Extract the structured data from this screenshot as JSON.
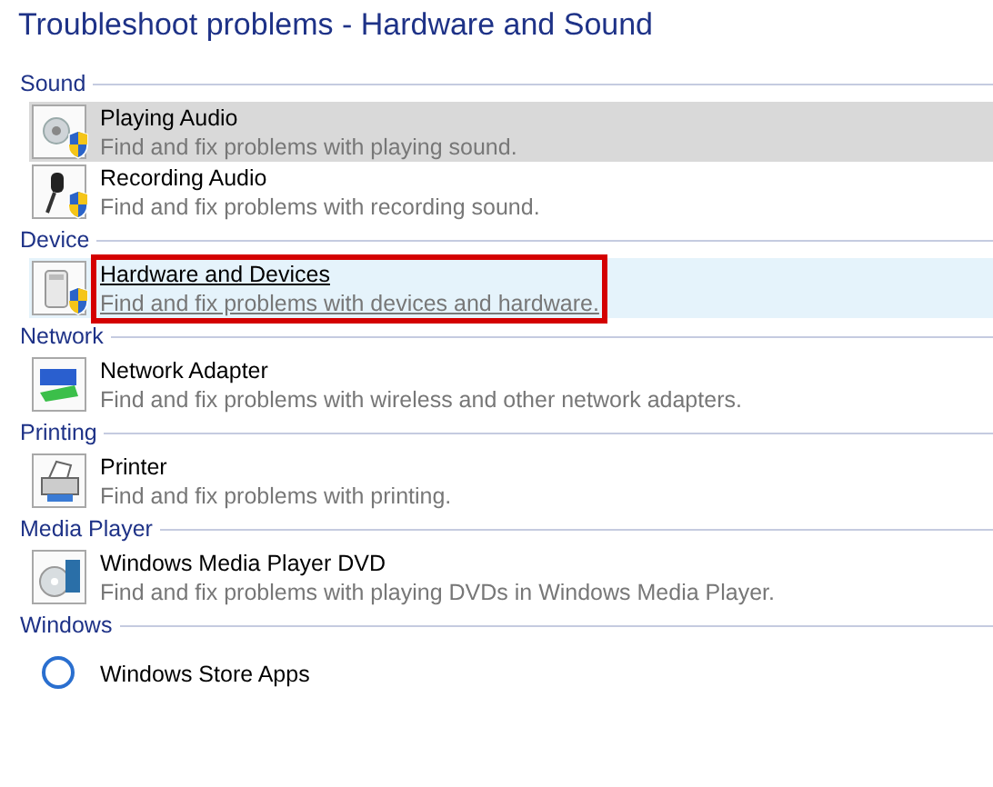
{
  "title": "Troubleshoot problems - Hardware and Sound",
  "sections": [
    {
      "name": "Sound",
      "items": [
        {
          "kind": "speaker",
          "shield": true,
          "title": "Playing Audio",
          "description": "Find and fix problems with playing sound.",
          "hovered": true,
          "selected": false,
          "outlined": false
        },
        {
          "kind": "microphone",
          "shield": true,
          "title": "Recording Audio",
          "description": "Find and fix problems with recording sound.",
          "hovered": false,
          "selected": false,
          "outlined": false
        }
      ]
    },
    {
      "name": "Device",
      "items": [
        {
          "kind": "device",
          "shield": true,
          "title": "Hardware and Devices",
          "description": "Find and fix problems with devices and hardware.",
          "hovered": false,
          "selected": true,
          "outlined": true
        }
      ]
    },
    {
      "name": "Network",
      "items": [
        {
          "kind": "network",
          "shield": false,
          "title": "Network Adapter",
          "description": "Find and fix problems with wireless and other network adapters.",
          "hovered": false,
          "selected": false,
          "outlined": false
        }
      ]
    },
    {
      "name": "Printing",
      "items": [
        {
          "kind": "printer",
          "shield": false,
          "title": "Printer",
          "description": "Find and fix problems with printing.",
          "hovered": false,
          "selected": false,
          "outlined": false
        }
      ]
    },
    {
      "name": "Media Player",
      "items": [
        {
          "kind": "dvd",
          "shield": false,
          "title": "Windows Media Player DVD",
          "description": "Find and fix problems with playing DVDs in Windows Media Player.",
          "hovered": false,
          "selected": false,
          "outlined": false
        }
      ]
    },
    {
      "name": "Windows",
      "items": [
        {
          "kind": "store",
          "shield": false,
          "title": "Windows Store Apps",
          "hovered": false,
          "selected": false,
          "outlined": false
        }
      ]
    }
  ]
}
